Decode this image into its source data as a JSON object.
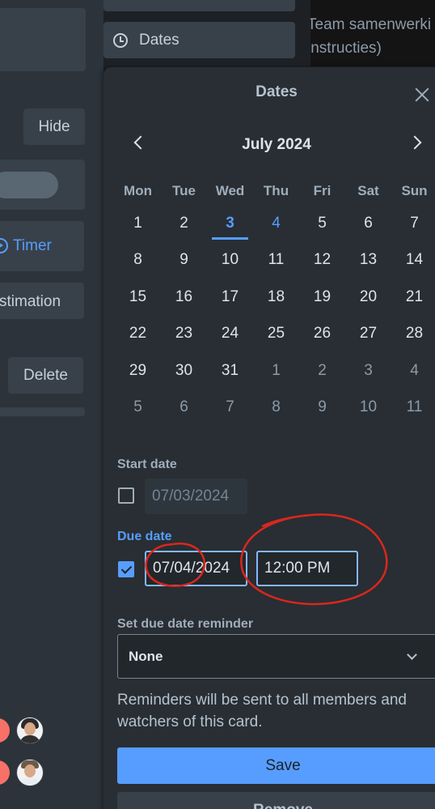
{
  "left_panel": {
    "hide_label": "Hide",
    "timer_label": "Timer",
    "estimation_label": "stimation",
    "delete_label": "Delete"
  },
  "sidebar": {
    "dates_button_label": "Dates"
  },
  "background_description": {
    "line1": "Team samenwerki",
    "line2": "instructies)"
  },
  "popover": {
    "title": "Dates",
    "month_label": "July 2024",
    "weekdays": [
      "Mon",
      "Tue",
      "Wed",
      "Thu",
      "Fri",
      "Sat",
      "Sun"
    ],
    "days": [
      {
        "label": "1",
        "state": "normal"
      },
      {
        "label": "2",
        "state": "normal"
      },
      {
        "label": "3",
        "state": "today"
      },
      {
        "label": "4",
        "state": "selected"
      },
      {
        "label": "5",
        "state": "normal"
      },
      {
        "label": "6",
        "state": "normal"
      },
      {
        "label": "7",
        "state": "normal"
      },
      {
        "label": "8",
        "state": "normal"
      },
      {
        "label": "9",
        "state": "normal"
      },
      {
        "label": "10",
        "state": "normal"
      },
      {
        "label": "11",
        "state": "normal"
      },
      {
        "label": "12",
        "state": "normal"
      },
      {
        "label": "13",
        "state": "normal"
      },
      {
        "label": "14",
        "state": "normal"
      },
      {
        "label": "15",
        "state": "normal"
      },
      {
        "label": "16",
        "state": "normal"
      },
      {
        "label": "17",
        "state": "normal"
      },
      {
        "label": "18",
        "state": "normal"
      },
      {
        "label": "19",
        "state": "normal"
      },
      {
        "label": "20",
        "state": "normal"
      },
      {
        "label": "21",
        "state": "normal"
      },
      {
        "label": "22",
        "state": "normal"
      },
      {
        "label": "23",
        "state": "normal"
      },
      {
        "label": "24",
        "state": "normal"
      },
      {
        "label": "25",
        "state": "normal"
      },
      {
        "label": "26",
        "state": "normal"
      },
      {
        "label": "27",
        "state": "normal"
      },
      {
        "label": "28",
        "state": "normal"
      },
      {
        "label": "29",
        "state": "normal"
      },
      {
        "label": "30",
        "state": "normal"
      },
      {
        "label": "31",
        "state": "normal"
      },
      {
        "label": "1",
        "state": "muted"
      },
      {
        "label": "2",
        "state": "muted"
      },
      {
        "label": "3",
        "state": "muted"
      },
      {
        "label": "4",
        "state": "muted"
      },
      {
        "label": "5",
        "state": "muted"
      },
      {
        "label": "6",
        "state": "muted"
      },
      {
        "label": "7",
        "state": "muted"
      },
      {
        "label": "8",
        "state": "muted"
      },
      {
        "label": "9",
        "state": "muted"
      },
      {
        "label": "10",
        "state": "muted"
      },
      {
        "label": "11",
        "state": "muted"
      }
    ],
    "start_date": {
      "label": "Start date",
      "checked": false,
      "placeholder": "07/03/2024"
    },
    "due_date": {
      "label": "Due date",
      "checked": true,
      "date_value": "07/04/2024",
      "time_value": "12:00 PM"
    },
    "reminder": {
      "label": "Set due date reminder",
      "selected": "None",
      "note": "Reminders will be sent to all members and watchers of this card."
    },
    "save_label": "Save",
    "remove_label": "Remove"
  },
  "colors": {
    "accent": "#579dff",
    "annotation": "#d9271e",
    "popover_bg": "#282e33"
  },
  "icons": [
    "clock-icon",
    "close-icon",
    "chevron-left-icon",
    "chevron-right-icon",
    "chevron-down-icon",
    "play-circle-icon",
    "check-icon"
  ]
}
